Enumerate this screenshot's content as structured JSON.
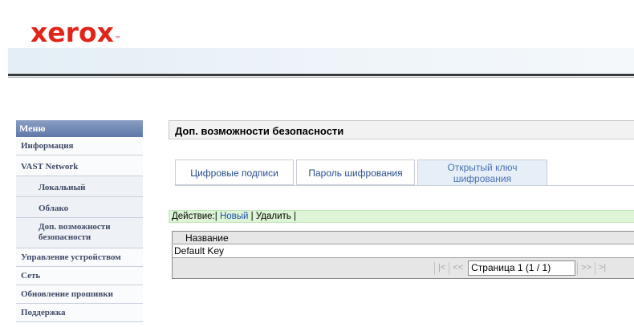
{
  "header": {
    "logo_text": "xerox",
    "logo_tm": "™",
    "brand_color": "#e2231a"
  },
  "sidebar": {
    "title": "Меню",
    "items": [
      {
        "label": "Информация",
        "level": 0
      },
      {
        "label": "VAST Network",
        "level": 0
      },
      {
        "label": "Локальный",
        "level": 1
      },
      {
        "label": "Облако",
        "level": 1
      },
      {
        "label": "Доп. возможности безопасности",
        "level": 1
      },
      {
        "label": "Управление устройством",
        "level": 0
      },
      {
        "label": "Сеть",
        "level": 0
      },
      {
        "label": "Обновление прошивки",
        "level": 0
      },
      {
        "label": "Поддержка",
        "level": 0
      }
    ]
  },
  "main": {
    "page_title": "Доп. возможности безопасности",
    "tabs": [
      {
        "label": "Цифровые подписи",
        "active": false
      },
      {
        "label": "Пароль шифрования",
        "active": false
      },
      {
        "label_line1": "Открытый ключ",
        "label_line2": "шифрования",
        "active": true
      }
    ],
    "action_bar": {
      "prefix": "Действие:|",
      "new_label": "Новый",
      "sep": "|",
      "delete_label": "Удалить",
      "suffix": "|"
    },
    "grid": {
      "columns": [
        "Название"
      ],
      "rows": [
        [
          "Default Key"
        ]
      ],
      "pager": {
        "first": "|<",
        "prev": "<<",
        "page_text": "Страница 1 (1 / 1)",
        "next": ">>",
        "last": ">|"
      }
    }
  }
}
